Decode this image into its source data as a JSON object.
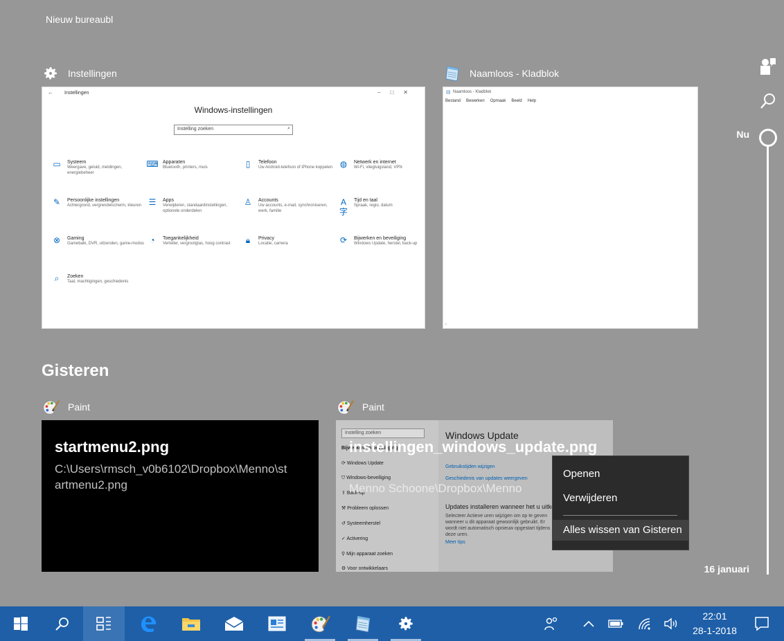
{
  "desktop": {
    "label": "Nieuw bureaubl"
  },
  "now_section": {
    "cards": [
      {
        "app": "Instellingen",
        "icon": "gear-icon"
      },
      {
        "app": "Naamloos - Kladblok",
        "icon": "notepad-icon"
      }
    ]
  },
  "settings_window": {
    "title": "Instellingen",
    "heading": "Windows-instellingen",
    "search_placeholder": "Instelling zoeken",
    "items": [
      {
        "title": "Systeem",
        "desc": "Weergave, geluid, meldingen, energiebeheer"
      },
      {
        "title": "Apparaten",
        "desc": "Bluetooth, printers, muis"
      },
      {
        "title": "Telefoon",
        "desc": "Uw Android-telefoon of iPhone koppelen"
      },
      {
        "title": "Netwerk en internet",
        "desc": "Wi-Fi, vliegtuigstand, VPN"
      },
      {
        "title": "Persoonlijke instellingen",
        "desc": "Achtergrond, vergrendelscherm, kleuren"
      },
      {
        "title": "Apps",
        "desc": "Verwijderen, standaardinstellingen, optionele onderdelen"
      },
      {
        "title": "Accounts",
        "desc": "Uw accounts, e-mail, synchroniseren, werk, familie"
      },
      {
        "title": "Tijd en taal",
        "desc": "Spraak, regio, datum"
      },
      {
        "title": "Gaming",
        "desc": "Gamebalk, DVR, uitzenden, game-modus"
      },
      {
        "title": "Toegankelijkheid",
        "desc": "Verteller, vergrootglas, hoog contrast"
      },
      {
        "title": "Privacy",
        "desc": "Locatie, camera"
      },
      {
        "title": "Bijwerken en beveiliging",
        "desc": "Windows Update, herstel, back-up"
      },
      {
        "title": "Zoeken",
        "desc": "Taal, machtigingen, geschiedenis"
      }
    ]
  },
  "notepad_window": {
    "title": "Naamloos - Kladblok",
    "menu": [
      "Bestand",
      "Bewerken",
      "Opmaak",
      "Beeld",
      "Help"
    ]
  },
  "yesterday_section": {
    "title": "Gisteren",
    "cards": [
      {
        "app": "Paint",
        "file_name": "startmenu2.png",
        "file_path": "C:\\Users\\rmsch_v0b6102\\Dropbox\\Menno\\startmenu2.png"
      },
      {
        "app": "Paint",
        "file_name": "instellingen_windows_update.png",
        "file_path": "Menno Schoone\\Dropbox\\Menno"
      }
    ]
  },
  "wu_window": {
    "search_placeholder": "Instelling zoeken",
    "nav": [
      "Bijwerken en beveiliging",
      "Windows Update",
      "Windows-beveiliging",
      "Back-up",
      "Probleem oplossen",
      "Systeemherstel",
      "Activering",
      "Mijn apparaat zoeken",
      "Voor ontwikkelaars"
    ],
    "heading": "Windows Update",
    "link1": "Gebruikstijden wijzigen",
    "link2": "Geschiedenis van updates weergeven",
    "sub": "Updates installeren wanneer het u uitkomt",
    "text": "Selecteer Actieve uren wijzigen om op te geven wanneer u dit apparaat gewoonlijk gebruikt. Er wordt niet automatisch opnieuw opgestart tijdens deze uren.",
    "more": "Meer tips"
  },
  "context_menu": {
    "items": [
      "Openen",
      "Verwijderen",
      "Alles wissen van Gisteren"
    ]
  },
  "timeline": {
    "now_label": "Nu",
    "date_label": "16 januari"
  },
  "taskbar": {
    "time": "22:01",
    "date": "28-1-2018"
  },
  "colors": {
    "background": "#979797",
    "taskbar": "#1e5fa8",
    "context_menu": "#2b2b2b"
  }
}
